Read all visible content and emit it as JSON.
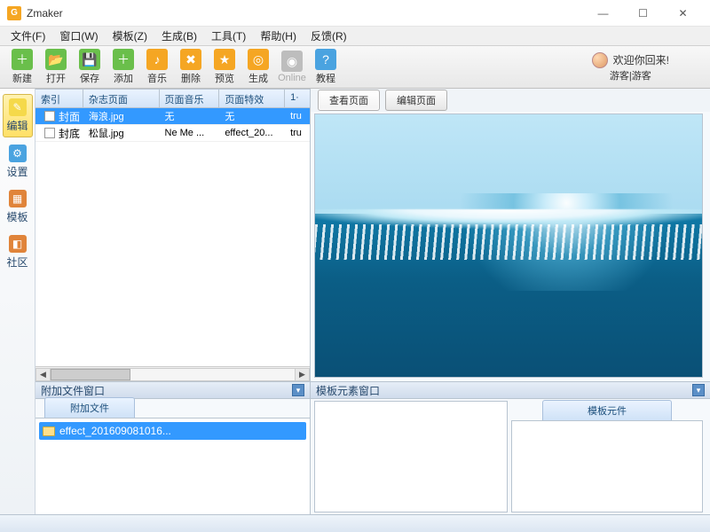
{
  "window": {
    "title": "Zmaker"
  },
  "menu": {
    "file": "文件(F)",
    "window": "窗口(W)",
    "template": "模板(Z)",
    "generate": "生成(B)",
    "tools": "工具(T)",
    "help": "帮助(H)",
    "feedback": "反馈(R)"
  },
  "toolbar": {
    "new": "新建",
    "open": "打开",
    "save": "保存",
    "add": "添加",
    "music": "音乐",
    "delete": "删除",
    "preview": "预览",
    "generate": "生成",
    "online": "Online",
    "tutorial": "教程"
  },
  "welcome": {
    "greeting": "欢迎你回来!",
    "user": "游客|游客"
  },
  "sidetabs": {
    "edit": "编辑",
    "settings": "设置",
    "template": "模板",
    "community": "社区"
  },
  "grid": {
    "cols": {
      "index": "索引",
      "page": "杂志页面",
      "music": "页面音乐",
      "effect": "页面特效",
      "extra": "1·"
    },
    "rows": [
      {
        "index": "封面",
        "page": "海浪.jpg",
        "music": "无",
        "effect": "无",
        "extra": "tru",
        "selected": true
      },
      {
        "index": "封底",
        "page": "松鼠.jpg",
        "music": "Ne Me ...",
        "effect": "effect_20...",
        "extra": "tru",
        "selected": false
      }
    ]
  },
  "attach": {
    "panel_title": "附加文件窗口",
    "tab": "附加文件",
    "items": [
      "effect_201609081016..."
    ]
  },
  "preview": {
    "tabs": {
      "view": "查看页面",
      "edit": "编辑页面"
    }
  },
  "tpl_panel": {
    "title": "模板元素窗口",
    "tab": "模板元件"
  }
}
